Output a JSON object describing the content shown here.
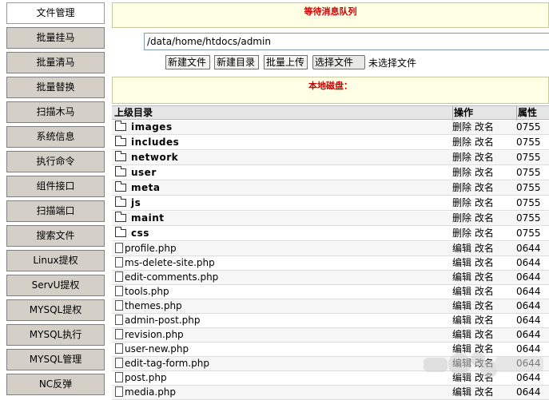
{
  "sidebar": {
    "items": [
      {
        "label": "文件管理",
        "active": true
      },
      {
        "label": "批量挂马"
      },
      {
        "label": "批量清马"
      },
      {
        "label": "批量替换"
      },
      {
        "label": "扫描木马"
      },
      {
        "label": "系统信息"
      },
      {
        "label": "执行命令"
      },
      {
        "label": "组件接口"
      },
      {
        "label": "扫描端口"
      },
      {
        "label": "搜索文件"
      },
      {
        "label": "Linux提权"
      },
      {
        "label": "ServU提权"
      },
      {
        "label": "MYSQL提权"
      },
      {
        "label": "MYSQL执行"
      },
      {
        "label": "MYSQL管理"
      },
      {
        "label": "NC反弹"
      }
    ]
  },
  "queue_banner": "等待消息队列",
  "path_input": "/data/home/htdocs/admin",
  "toolbar": {
    "new_file": "新建文件",
    "new_dir": "新建目录",
    "batch_upload": "批量上传",
    "choose_file": "选择文件",
    "file_status": "未选择文件"
  },
  "disk_banner": "本地磁盘：",
  "table": {
    "headers": {
      "name": "上级目录",
      "ops": "操作",
      "perm": "属性"
    },
    "dirs": [
      {
        "name": "images",
        "ops": "删除 改名",
        "perm": "0755"
      },
      {
        "name": "includes",
        "ops": "删除 改名",
        "perm": "0755"
      },
      {
        "name": "network",
        "ops": "删除 改名",
        "perm": "0755"
      },
      {
        "name": "user",
        "ops": "删除 改名",
        "perm": "0755"
      },
      {
        "name": "meta",
        "ops": "删除 改名",
        "perm": "0755"
      },
      {
        "name": "js",
        "ops": "删除 改名",
        "perm": "0755"
      },
      {
        "name": "maint",
        "ops": "删除 改名",
        "perm": "0755"
      },
      {
        "name": "css",
        "ops": "删除 改名",
        "perm": "0755"
      }
    ],
    "files": [
      {
        "name": "profile.php",
        "ops": "编辑 改名",
        "perm": "0644"
      },
      {
        "name": "ms-delete-site.php",
        "ops": "编辑 改名",
        "perm": "0644"
      },
      {
        "name": "edit-comments.php",
        "ops": "编辑 改名",
        "perm": "0644"
      },
      {
        "name": "tools.php",
        "ops": "编辑 改名",
        "perm": "0644"
      },
      {
        "name": "themes.php",
        "ops": "编辑 改名",
        "perm": "0644"
      },
      {
        "name": "admin-post.php",
        "ops": "编辑 改名",
        "perm": "0644"
      },
      {
        "name": "revision.php",
        "ops": "编辑 改名",
        "perm": "0644"
      },
      {
        "name": "user-new.php",
        "ops": "编辑 改名",
        "perm": "0644"
      },
      {
        "name": "edit-tag-form.php",
        "ops": "编辑 改名",
        "perm": "0644"
      },
      {
        "name": "post.php",
        "ops": "编辑 改名",
        "perm": "0644"
      },
      {
        "name": "media.php",
        "ops": "编辑 改名",
        "perm": "0644"
      }
    ]
  },
  "colors": {
    "banner_bg": "#ffffe6",
    "banner_text": "#cc0000",
    "nav_bg": "#d4d0c8"
  }
}
